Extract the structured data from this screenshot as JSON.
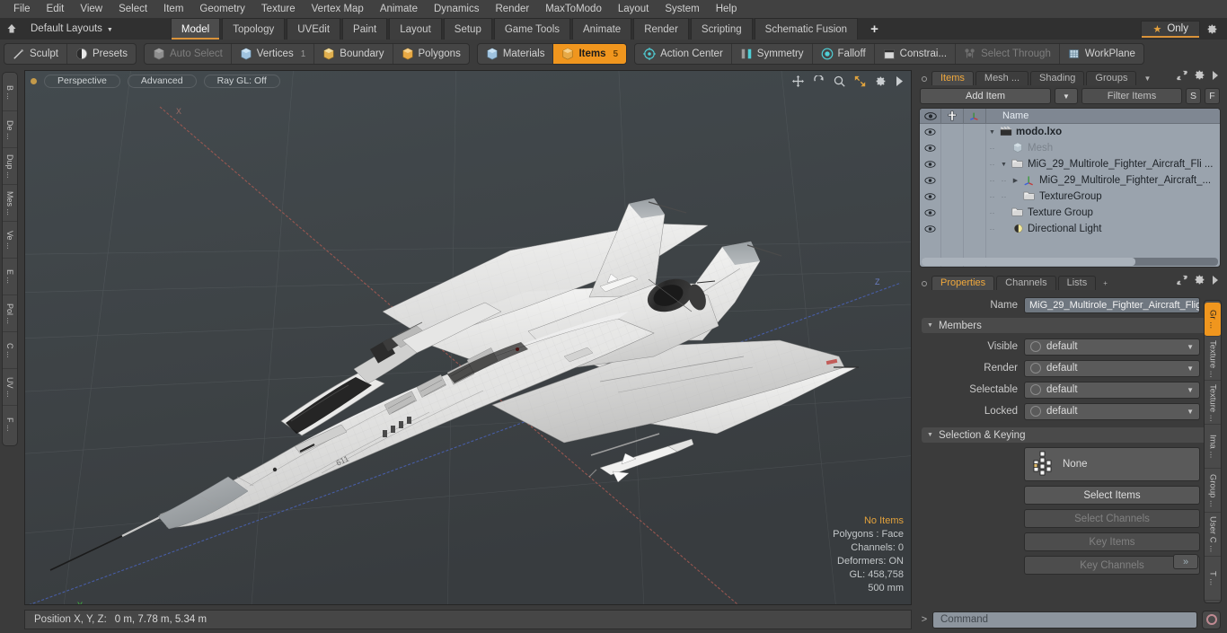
{
  "menubar": {
    "items": [
      "File",
      "Edit",
      "View",
      "Select",
      "Item",
      "Geometry",
      "Texture",
      "Vertex Map",
      "Animate",
      "Dynamics",
      "Render",
      "MaxToModo",
      "Layout",
      "System",
      "Help"
    ]
  },
  "layoutbar": {
    "home_icon": "home-icon",
    "layout_label": "Default Layouts",
    "tabs": [
      {
        "label": "Model",
        "active": true
      },
      {
        "label": "Topology",
        "active": false
      },
      {
        "label": "UVEdit",
        "active": false
      },
      {
        "label": "Paint",
        "active": false
      },
      {
        "label": "Layout",
        "active": false
      },
      {
        "label": "Setup",
        "active": false
      },
      {
        "label": "Game Tools",
        "active": false
      },
      {
        "label": "Animate",
        "active": false
      },
      {
        "label": "Render",
        "active": false
      },
      {
        "label": "Scripting",
        "active": false
      },
      {
        "label": "Schematic Fusion",
        "active": false
      }
    ],
    "add_label": "+",
    "only_label": "Only",
    "gear_icon": "gear-icon",
    "accent": "#d9923a"
  },
  "toolbar": {
    "group1": [
      {
        "label": "Sculpt",
        "icon": "sculpt-icon",
        "state": "normal"
      },
      {
        "label": "Presets",
        "icon": "presets-icon",
        "state": "normal"
      }
    ],
    "group2": [
      {
        "label": "Auto Select",
        "icon": "cube-icon",
        "state": "disabled",
        "count": ""
      },
      {
        "label": "Vertices",
        "icon": "vertices-icon",
        "state": "normal",
        "count": "1"
      },
      {
        "label": "Boundary",
        "icon": "boundary-icon",
        "state": "normal",
        "count": ""
      },
      {
        "label": "Polygons",
        "icon": "polygons-icon",
        "state": "normal",
        "count": ""
      }
    ],
    "group3": [
      {
        "label": "Materials",
        "icon": "materials-icon",
        "state": "normal",
        "count": ""
      },
      {
        "label": "Items",
        "icon": "items-icon",
        "state": "selected",
        "count": "5"
      }
    ],
    "group4": [
      {
        "label": "Action Center",
        "icon": "action-center-icon",
        "state": "normal"
      },
      {
        "label": "Symmetry",
        "icon": "symmetry-icon",
        "state": "normal"
      },
      {
        "label": "Falloff",
        "icon": "falloff-icon",
        "state": "normal"
      },
      {
        "label": "Constrai...",
        "icon": "constraint-icon",
        "state": "normal"
      },
      {
        "label": "Select Through",
        "icon": "select-through-icon",
        "state": "disabled"
      },
      {
        "label": "WorkPlane",
        "icon": "workplane-icon",
        "state": "normal"
      }
    ]
  },
  "left_rail": {
    "tabs": [
      "B ...",
      "De ...",
      "Dup ...",
      "Mes ...",
      "Ve ...",
      "E ...",
      "Pol ...",
      "C ...",
      "UV ...",
      "F ..."
    ]
  },
  "viewport": {
    "pills": [
      "Perspective",
      "Advanced",
      "Ray GL: Off"
    ],
    "header_icons": [
      "move-icon",
      "rotate-icon",
      "zoom-icon",
      "fit-icon",
      "gear-icon",
      "chevron-right-icon"
    ],
    "axis_gizmo": {
      "x": "X",
      "y": "Y",
      "z": "Z"
    },
    "stats": [
      {
        "text": "No Items",
        "highlight": true
      },
      {
        "text": "Polygons : Face",
        "highlight": false
      },
      {
        "text": "Channels: 0",
        "highlight": false
      },
      {
        "text": "Deformers: ON",
        "highlight": false
      },
      {
        "text": "GL: 458,758",
        "highlight": false
      },
      {
        "text": "500 mm",
        "highlight": false
      }
    ],
    "bg_color": "#3f4447",
    "highlight_color": "#e3a23c"
  },
  "items_panel": {
    "tabs": [
      {
        "label": "Items",
        "active": true
      },
      {
        "label": "Mesh ...",
        "active": false
      },
      {
        "label": "Shading",
        "active": false
      },
      {
        "label": "Groups",
        "active": false
      }
    ],
    "tab_caret": "▼",
    "add_item_label": "Add Item",
    "add_item_caret": "▼",
    "filter_placeholder": "Filter Items",
    "btn_s": "S",
    "btn_f": "F",
    "columns": [
      "eye-icon",
      "lock-icon",
      "axis-icon",
      "Name"
    ],
    "rows": [
      {
        "name": "modo.lxo",
        "icon": "scene-icon",
        "indent": 0,
        "tri": "▼",
        "bold": true,
        "dimmed": false
      },
      {
        "name": "Mesh",
        "icon": "mesh-icon",
        "indent": 1,
        "tri": "",
        "bold": false,
        "dimmed": true
      },
      {
        "name": "MiG_29_Multirole_Fighter_Aircraft_Fli ...",
        "icon": "group-icon",
        "indent": 1,
        "tri": "▼",
        "bold": false,
        "dimmed": false
      },
      {
        "name": "MiG_29_Multirole_Fighter_Aircraft_...",
        "icon": "locator-icon",
        "indent": 2,
        "tri": "▶",
        "bold": false,
        "dimmed": false
      },
      {
        "name": "TextureGroup",
        "icon": "group-icon",
        "indent": 2,
        "tri": "",
        "bold": false,
        "dimmed": false
      },
      {
        "name": "Texture Group",
        "icon": "group-icon",
        "indent": 1,
        "tri": "",
        "bold": false,
        "dimmed": false
      },
      {
        "name": "Directional Light",
        "icon": "light-icon",
        "indent": 1,
        "tri": "",
        "bold": false,
        "dimmed": false
      }
    ]
  },
  "properties_panel": {
    "tabs": [
      {
        "label": "Properties",
        "active": true
      },
      {
        "label": "Channels",
        "active": false
      },
      {
        "label": "Lists",
        "active": false
      }
    ],
    "add_tab": "+",
    "name_label": "Name",
    "name_value": "MiG_29_Multirole_Fighter_Aircraft_Flig",
    "members_section": "Members",
    "members": [
      {
        "label": "Visible",
        "value": "default"
      },
      {
        "label": "Render",
        "value": "default"
      },
      {
        "label": "Selectable",
        "value": "default"
      },
      {
        "label": "Locked",
        "value": "default"
      }
    ],
    "selection_section": "Selection & Keying",
    "selection_none": "None",
    "buttons": [
      {
        "label": "Select Items",
        "enabled": true
      },
      {
        "label": "Select Channels",
        "enabled": false
      },
      {
        "label": "Key Items",
        "enabled": false
      },
      {
        "label": "Key Channels",
        "enabled": false
      }
    ],
    "forward_label": "»"
  },
  "right_rail": {
    "tabs": [
      {
        "label": "Gr ...",
        "active": true
      },
      {
        "label": "Texture ...",
        "active": false
      },
      {
        "label": "Texture ...",
        "active": false
      },
      {
        "label": "Ima ...",
        "active": false
      },
      {
        "label": "Group ...",
        "active": false
      },
      {
        "label": "User C ...",
        "active": false
      },
      {
        "label": "T ...",
        "active": false
      }
    ]
  },
  "statusbar": {
    "position_label": "Position X, Y, Z:",
    "position_value": "0 m, 7.78 m, 5.34 m",
    "command_chevron": ">",
    "command_placeholder": "Command",
    "record_icon": "record-icon"
  }
}
